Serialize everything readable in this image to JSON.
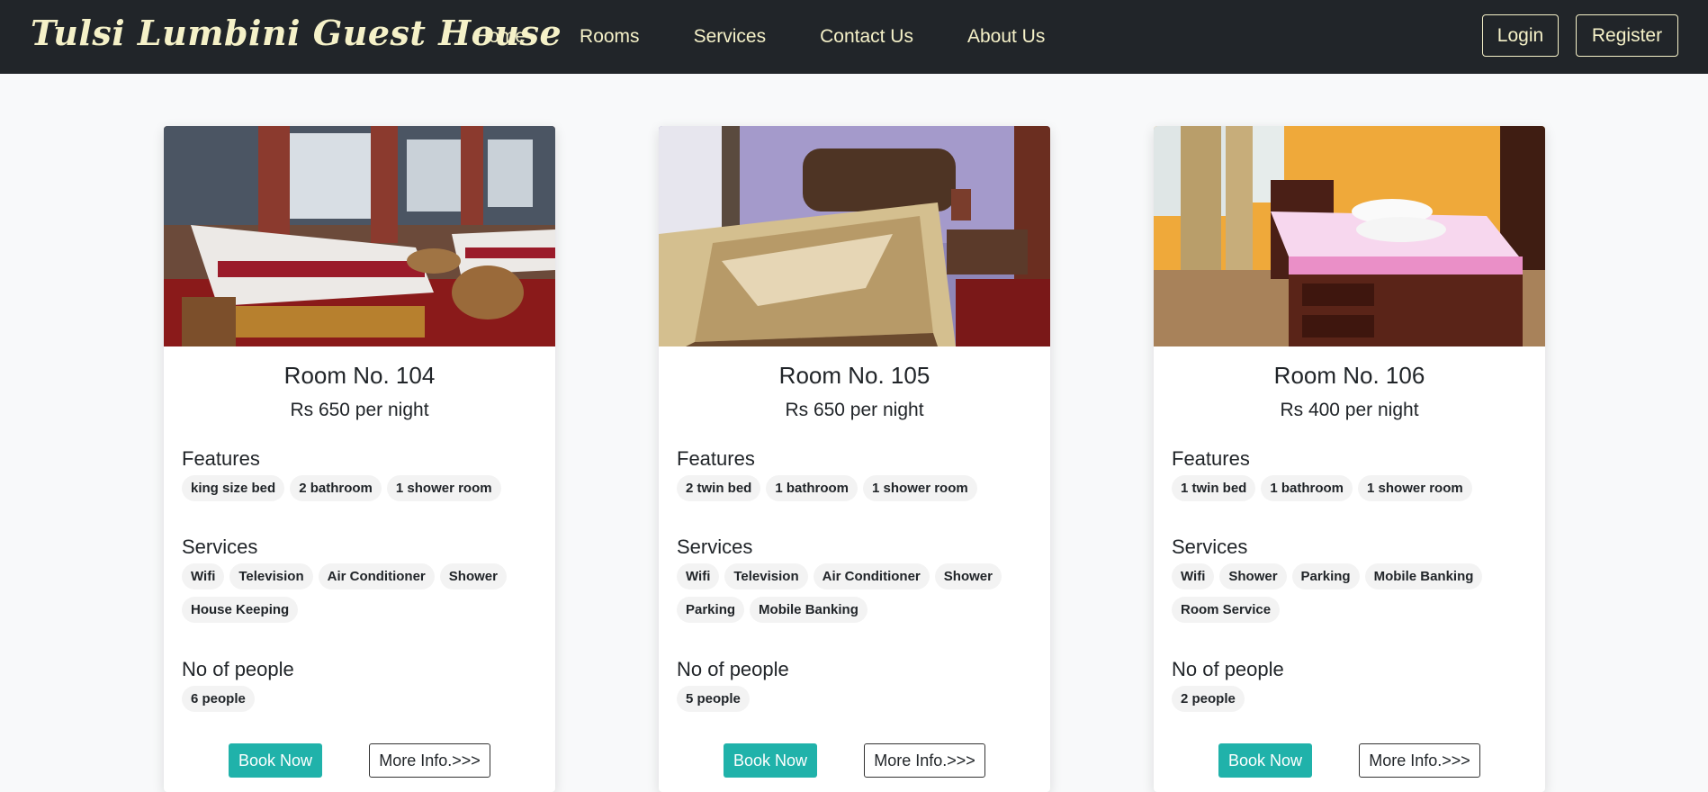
{
  "navbar": {
    "brand": "Tulsi Lumbini Guest House",
    "links": [
      "Home",
      "Rooms",
      "Services",
      "Contact Us",
      "About Us"
    ],
    "login": "Login",
    "register": "Register"
  },
  "labels": {
    "features": "Features",
    "services": "Services",
    "people": "No of people",
    "book": "Book Now",
    "more": "More Info.>>>"
  },
  "rooms": [
    {
      "title": "Room No. 104",
      "price": "Rs 650 per night",
      "features": [
        "king size bed",
        "2 bathroom",
        "1 shower room"
      ],
      "services": [
        "Wifi",
        "Television",
        "Air Conditioner",
        "Shower",
        "House Keeping"
      ],
      "people": "6 people"
    },
    {
      "title": "Room No. 105",
      "price": "Rs 650 per night",
      "features": [
        "2 twin bed",
        "1 bathroom",
        "1 shower room"
      ],
      "services": [
        "Wifi",
        "Television",
        "Air Conditioner",
        "Shower",
        "Parking",
        "Mobile Banking"
      ],
      "people": "5 people"
    },
    {
      "title": "Room No. 106",
      "price": "Rs 400 per night",
      "features": [
        "1 twin bed",
        "1 bathroom",
        "1 shower room"
      ],
      "services": [
        "Wifi",
        "Shower",
        "Parking",
        "Mobile Banking",
        "Room Service"
      ],
      "people": "2 people"
    }
  ]
}
